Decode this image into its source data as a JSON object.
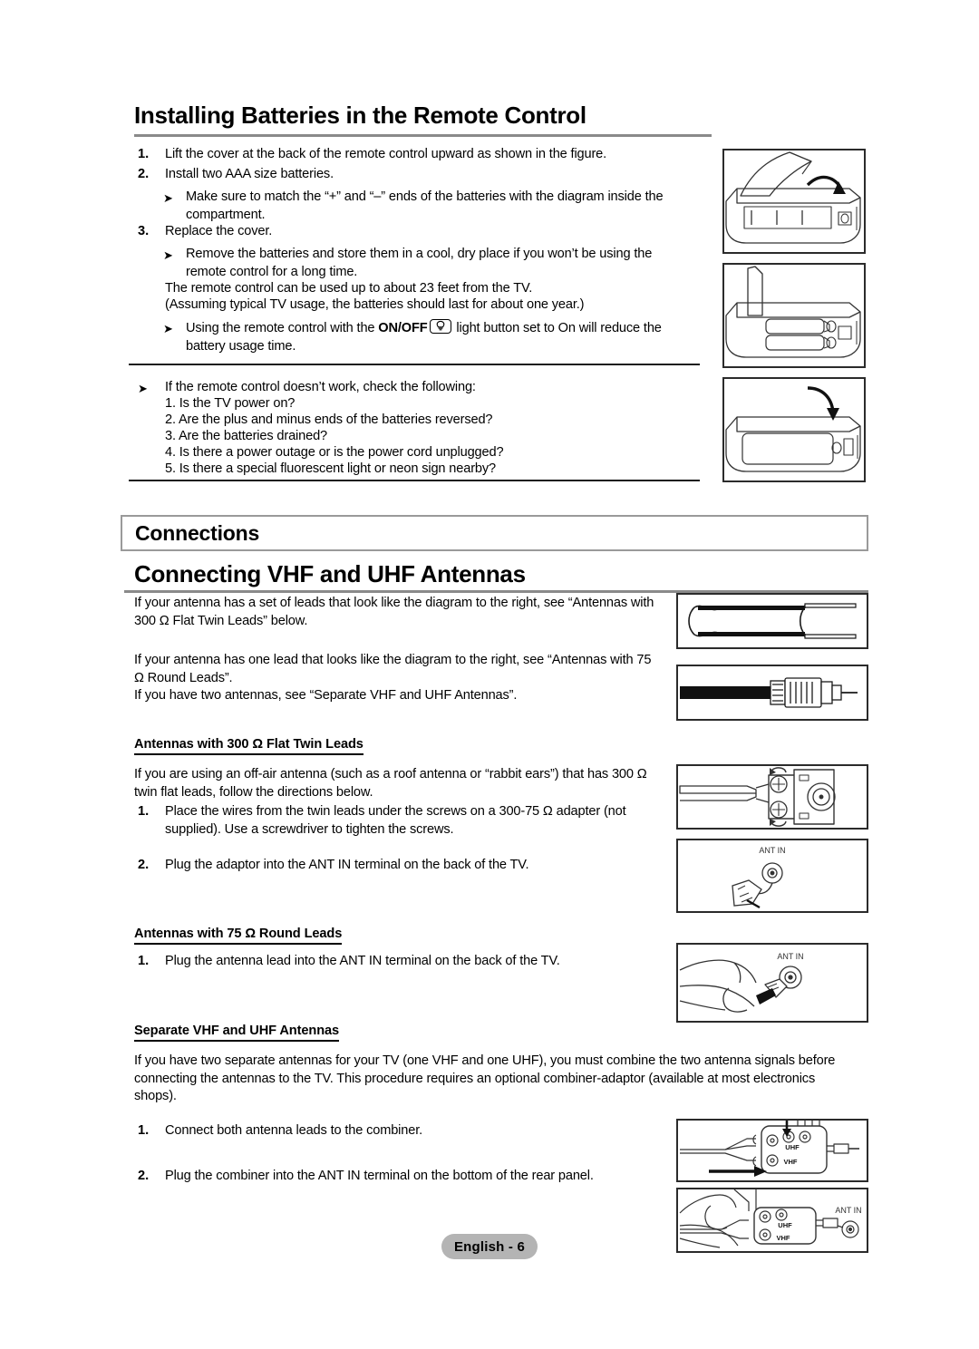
{
  "document": {
    "title": "Installing Batteries in the Remote Control",
    "footer_label": "English - 6"
  },
  "battery_section": {
    "heading": "Installing Batteries in the Remote Control",
    "steps": [
      {
        "number": "1.",
        "text": "Lift the cover at the back of the remote control upward as shown in the figure."
      },
      {
        "number": "2.",
        "text": "Install two AAA size batteries."
      }
    ],
    "note_1": "Make sure to match the “+” and “–” ends of the batteries with the diagram inside the compartment.",
    "step_3": {
      "number": "3.",
      "text": "Replace the cover."
    },
    "note_2": "Remove the batteries and store them in a cool, dry place if you won’t be using the remote control for a long time.",
    "range_line_1": "The remote control can be used up to about 23 feet from the TV.",
    "range_line_2": "(Assuming typical TV usage, the batteries should last for about one year.)",
    "note_3_pre": "Using the remote control with the ",
    "note_3_bold": "ON/OFF",
    "note_3_post": " light button set to On will reduce the battery usage time.",
    "onoff_icon": "light-bulb-icon"
  },
  "troubleshooting": {
    "intro": "If the remote control doesn’t work, check the following:",
    "items": [
      "1. Is the TV power on?",
      "2. Are the plus and minus ends of the batteries reversed?",
      "3. Are the batteries drained?",
      "4. Is there a power outage or is the power cord unplugged?",
      "5. Is there a special fluorescent light or neon sign nearby?"
    ]
  },
  "connections": {
    "section_label": "Connections",
    "heading": "Connecting VHF and UHF Antennas",
    "intro_1": "If your antenna has a set of leads that look like the diagram to the right, see “Antennas with 300 Ω Flat Twin Leads” below.",
    "intro_2": "If your antenna has one lead that looks like the diagram to the right, see “Antennas with 75 Ω Round Leads”.",
    "intro_3": "If you have two antennas, see “Separate VHF and UHF Antennas”."
  },
  "flat_twin": {
    "subheading": "Antennas with 300 Ω Flat Twin Leads",
    "intro": "If you are using an off-air antenna (such as a roof antenna or “rabbit ears”) that has 300 Ω twin flat leads, follow the directions below.",
    "steps": [
      {
        "number": "1.",
        "text": "Place the wires from the twin leads under the screws on a 300-75 Ω adapter (not supplied). Use a screwdriver to tighten the screws."
      },
      {
        "number": "2.",
        "text": "Plug the adaptor into the ANT IN terminal on the back of the TV."
      }
    ]
  },
  "round_leads": {
    "subheading": "Antennas with 75 Ω Round Leads",
    "steps": [
      {
        "number": "1.",
        "text": "Plug the antenna lead into the ANT IN terminal on the back of the TV."
      }
    ]
  },
  "separate_antennas": {
    "subheading": "Separate VHF and UHF Antennas",
    "intro": "If you have two separate antennas for your TV (one VHF and one UHF), you must combine the two antenna signals before connecting the antennas to the TV. This procedure requires an optional combiner-adaptor (available at most electronics shops).",
    "steps": [
      {
        "number": "1.",
        "text": "Connect both antenna leads to the combiner."
      },
      {
        "number": "2.",
        "text": "Plug the combiner into the ANT IN terminal on the bottom of the rear panel."
      }
    ]
  },
  "figures": {
    "remote_step1": "remote-cover-lift-diagram",
    "remote_step2": "remote-batteries-inserted-diagram",
    "remote_step3": "remote-cover-replace-diagram",
    "flat_twin_cable": "flat-twin-lead-cable-diagram",
    "coax_cable": "coaxial-round-lead-cable-diagram",
    "adapter_screws": "300-to-75-ohm-adapter-diagram",
    "adapter_ant_in": "adapter-into-ant-in-diagram",
    "hand_ant_in": "hand-plugging-ant-in-diagram",
    "combiner": "combiner-leads-diagram",
    "combiner_ant_in": "combiner-into-ant-in-diagram",
    "labels": {
      "ant_in": "ANT IN",
      "uhf": "UHF",
      "vhf": "VHF"
    }
  }
}
